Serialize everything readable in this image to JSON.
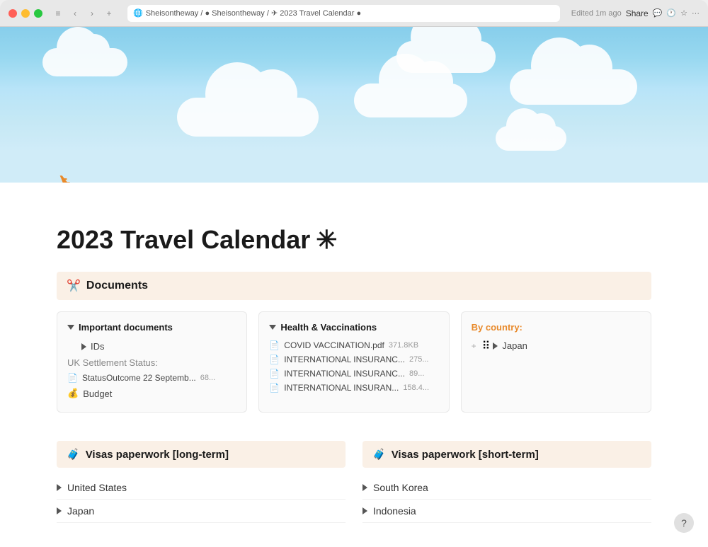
{
  "browser": {
    "breadcrumb": "Sheisontheway / ● Sheisontheway / ✈ 2023 Travel Calendar ●",
    "edited": "Edited 1m ago",
    "share": "Share",
    "more": "···"
  },
  "hero": {
    "airplane": "✈"
  },
  "page": {
    "title": "2023 Travel Calendar",
    "title_suffix": "✳"
  },
  "documents_section": {
    "header_icon": "✂",
    "header_label": "Documents",
    "important_docs": {
      "label": "Important documents",
      "ids_label": "IDs",
      "uk_label": "UK Settlement Status:",
      "file_name": "StatusOutcome 22 Septemb...",
      "file_size": "68...",
      "budget_label": "Budget",
      "budget_icon": "💰"
    },
    "health_vaccinations": {
      "label": "Health & Vaccinations",
      "files": [
        {
          "name": "COVID VACCINATION.pdf",
          "size": "371.8KB"
        },
        {
          "name": "INTERNATIONAL INSURANC...",
          "size": "275..."
        },
        {
          "name": "INTERNATIONAL INSURANC...",
          "size": "89..."
        },
        {
          "name": "INTERNATIONAL INSURAN...",
          "size": "158.4..."
        }
      ]
    },
    "by_country": {
      "label": "By country:",
      "items": [
        {
          "name": "Japan"
        }
      ]
    }
  },
  "visas_longterm": {
    "header_icon": "🧳",
    "header_label": "Visas paperwork [long-term]",
    "items": [
      {
        "name": "United States"
      },
      {
        "name": "Japan"
      }
    ]
  },
  "visas_shortterm": {
    "header_icon": "🧳",
    "header_label": "Visas paperwork [short-term]",
    "items": [
      {
        "name": "South Korea"
      },
      {
        "name": "Indonesia"
      }
    ]
  },
  "help": "?"
}
